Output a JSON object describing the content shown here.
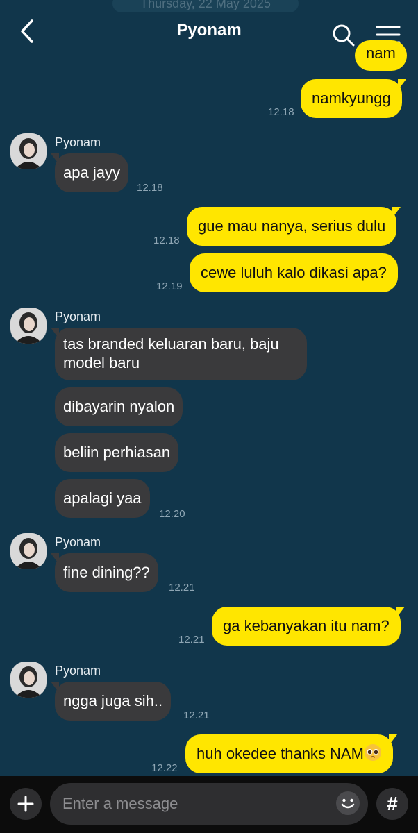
{
  "header": {
    "date_label": "Thursday, 22 May 2025",
    "title": "Pyonam",
    "back_icon": "chevron-left-icon",
    "search_icon": "search-icon",
    "menu_icon": "hamburger-menu-icon"
  },
  "colors": {
    "background": "#11364b",
    "outgoing_bubble": "#ffe600",
    "incoming_bubble": "#3a3a3c",
    "timestamp": "#8fa6b4"
  },
  "messages": [
    {
      "dir": "out",
      "text": "nam"
    },
    {
      "dir": "out",
      "text": "namkyungg",
      "time": "12.18"
    },
    {
      "dir": "in",
      "sender": "Pyonam",
      "text": "apa jayy",
      "time": "12.18"
    },
    {
      "dir": "out",
      "text": "gue mau nanya, serius dulu",
      "time": "12.18"
    },
    {
      "dir": "out",
      "text": "cewe luluh kalo dikasi apa?",
      "time": "12.19"
    },
    {
      "dir": "in",
      "sender": "Pyonam",
      "text_line1": "tas branded keluaran baru, baju",
      "text_line2": "model baru"
    },
    {
      "dir": "in",
      "text": "dibayarin nyalon"
    },
    {
      "dir": "in",
      "text": "beliin perhiasan"
    },
    {
      "dir": "in",
      "text": "apalagi yaa",
      "time": "12.20"
    },
    {
      "dir": "in",
      "sender": "Pyonam",
      "text": "fine dining??",
      "time": "12.21"
    },
    {
      "dir": "out",
      "text": "ga kebanyakan itu nam?",
      "time": "12.21"
    },
    {
      "dir": "in",
      "sender": "Pyonam",
      "text": "ngga juga sih..",
      "time": "12.21"
    },
    {
      "dir": "out",
      "text": "huh okedee thanks NAM",
      "emoji": "pleading-face-emoji",
      "time": "12.22"
    }
  ],
  "input": {
    "placeholder": "Enter a message",
    "plus_icon": "plus-icon",
    "emoji_icon": "emoji-smile-icon",
    "hash_label": "#"
  }
}
